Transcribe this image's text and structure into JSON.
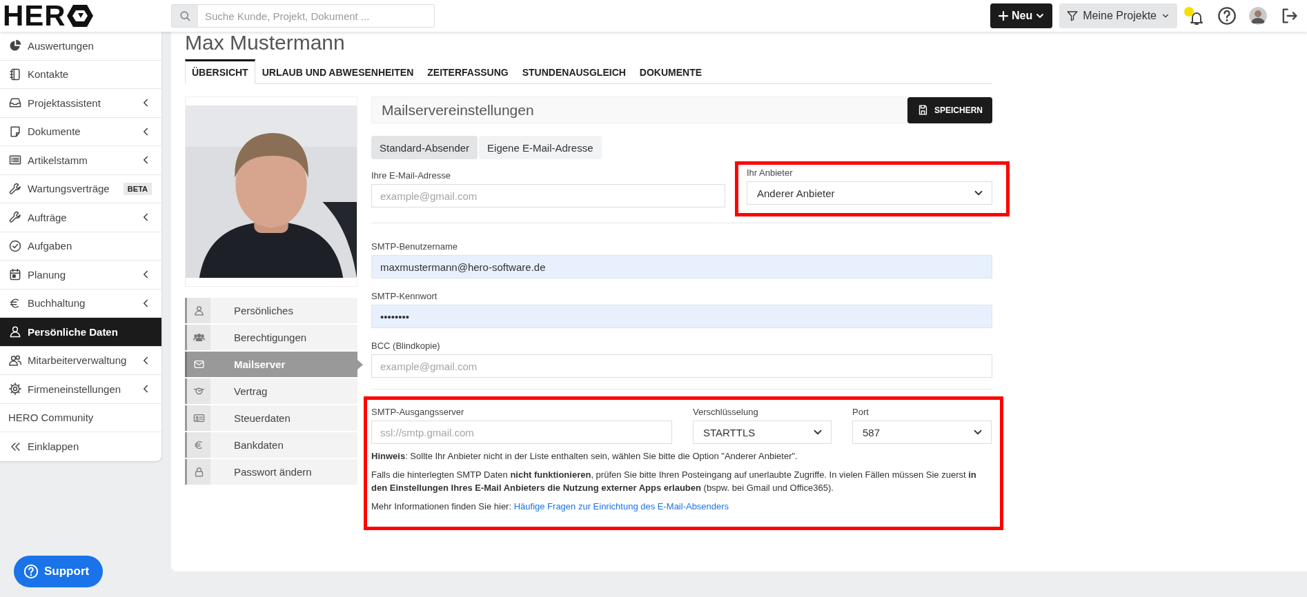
{
  "header": {
    "logo": "HER",
    "search": {
      "placeholder": "Suche Kunde, Projekt, Dokument ..."
    },
    "new_button": "Neu",
    "filter_button": "Meine Projekte",
    "notification_dot": true
  },
  "sidebar": {
    "items": [
      {
        "label": "Auswertungen",
        "has_submenu": false,
        "selected": false
      },
      {
        "label": "Kontakte",
        "has_submenu": false,
        "selected": false
      },
      {
        "label": "Projektassistent",
        "has_submenu": true,
        "selected": false
      },
      {
        "label": "Dokumente",
        "has_submenu": true,
        "selected": false
      },
      {
        "label": "Artikelstamm",
        "has_submenu": true,
        "selected": false
      },
      {
        "label": "Wartungsverträge",
        "has_submenu": false,
        "badge": "BETA",
        "selected": false
      },
      {
        "label": "Aufträge",
        "has_submenu": true,
        "selected": false
      },
      {
        "label": "Aufgaben",
        "has_submenu": false,
        "selected": false
      },
      {
        "label": "Planung",
        "has_submenu": true,
        "selected": false
      },
      {
        "label": "Buchhaltung",
        "has_submenu": true,
        "selected": false
      },
      {
        "label": "Persönliche Daten",
        "has_submenu": false,
        "selected": true
      },
      {
        "label": "Mitarbeiterverwaltung",
        "has_submenu": true,
        "selected": false
      },
      {
        "label": "Firmeneinstellungen",
        "has_submenu": true,
        "selected": false
      },
      {
        "label": "HERO Community",
        "has_submenu": false,
        "selected": false
      },
      {
        "label": "Einklappen",
        "has_submenu": false,
        "selected": false
      }
    ]
  },
  "page_title": "Max Mustermann",
  "tabs": [
    {
      "label": "ÜBERSICHT",
      "selected": true
    },
    {
      "label": "URLAUB UND ABWESENHEITEN",
      "selected": false
    },
    {
      "label": "ZEITERFASSUNG",
      "selected": false
    },
    {
      "label": "STUNDENAUSGLEICH",
      "selected": false
    },
    {
      "label": "DOKUMENTE",
      "selected": false
    }
  ],
  "profile": {
    "menu": [
      {
        "label": "Persönliches",
        "selected": false
      },
      {
        "label": "Berechtigungen",
        "selected": false
      },
      {
        "label": "Mailserver",
        "selected": true
      },
      {
        "label": "Vertrag",
        "selected": false
      },
      {
        "label": "Steuerdaten",
        "selected": false
      },
      {
        "label": "Bankdaten",
        "selected": false
      },
      {
        "label": "Passwort ändern",
        "selected": false
      }
    ]
  },
  "form": {
    "title": "Mailservereinstellungen",
    "save_button": "SPEICHERN",
    "sender_options": [
      {
        "label": "Standard-Absender",
        "selected": true
      },
      {
        "label": "Eigene E-Mail-Adresse",
        "selected": false
      }
    ],
    "email": {
      "label": "Ihre E-Mail-Adresse",
      "placeholder": "example@gmail.com"
    },
    "provider": {
      "label": "Ihr Anbieter",
      "value": "Anderer Anbieter",
      "highlighted": true
    },
    "smtp_user": {
      "label": "SMTP-Benutzername",
      "value": "maxmustermann@hero-software.de",
      "autofilled": true
    },
    "smtp_password": {
      "label": "SMTP-Kennwort",
      "value": "••••••••",
      "autofilled": true
    },
    "bcc": {
      "label": "BCC (Blindkopie)",
      "placeholder": "example@gmail.com"
    },
    "server_section": {
      "highlighted": true,
      "server": {
        "label": "SMTP-Ausgangsserver",
        "placeholder": "ssl://smtp.gmail.com"
      },
      "encryption": {
        "label": "Verschlüsselung",
        "value": "STARTTLS"
      },
      "port": {
        "label": "Port",
        "value": "587"
      },
      "notes": [
        {
          "text": "**Hinweis**: Sollte Ihr Anbieter nicht in der Liste enthalten sein, wählen Sie bitte die Option \"Anderer Anbieter\"."
        },
        {
          "text": "Falls die hinterlegten SMTP Daten **nicht funktionieren**, prüfen Sie bitte Ihren Posteingang auf unerlaubte Zugriffe. In vielen Fällen müssen Sie zuerst **in den Einstellungen Ihres E-Mail Anbieters die Nutzung externer Apps erlauben** (bspw. bei Gmail und Office365)."
        },
        {
          "text": "Mehr Informationen finden Sie hier:",
          "link": "Häufige Fragen zur Einrichtung des E-Mail-Absenders"
        }
      ]
    }
  },
  "support_button": "Support"
}
